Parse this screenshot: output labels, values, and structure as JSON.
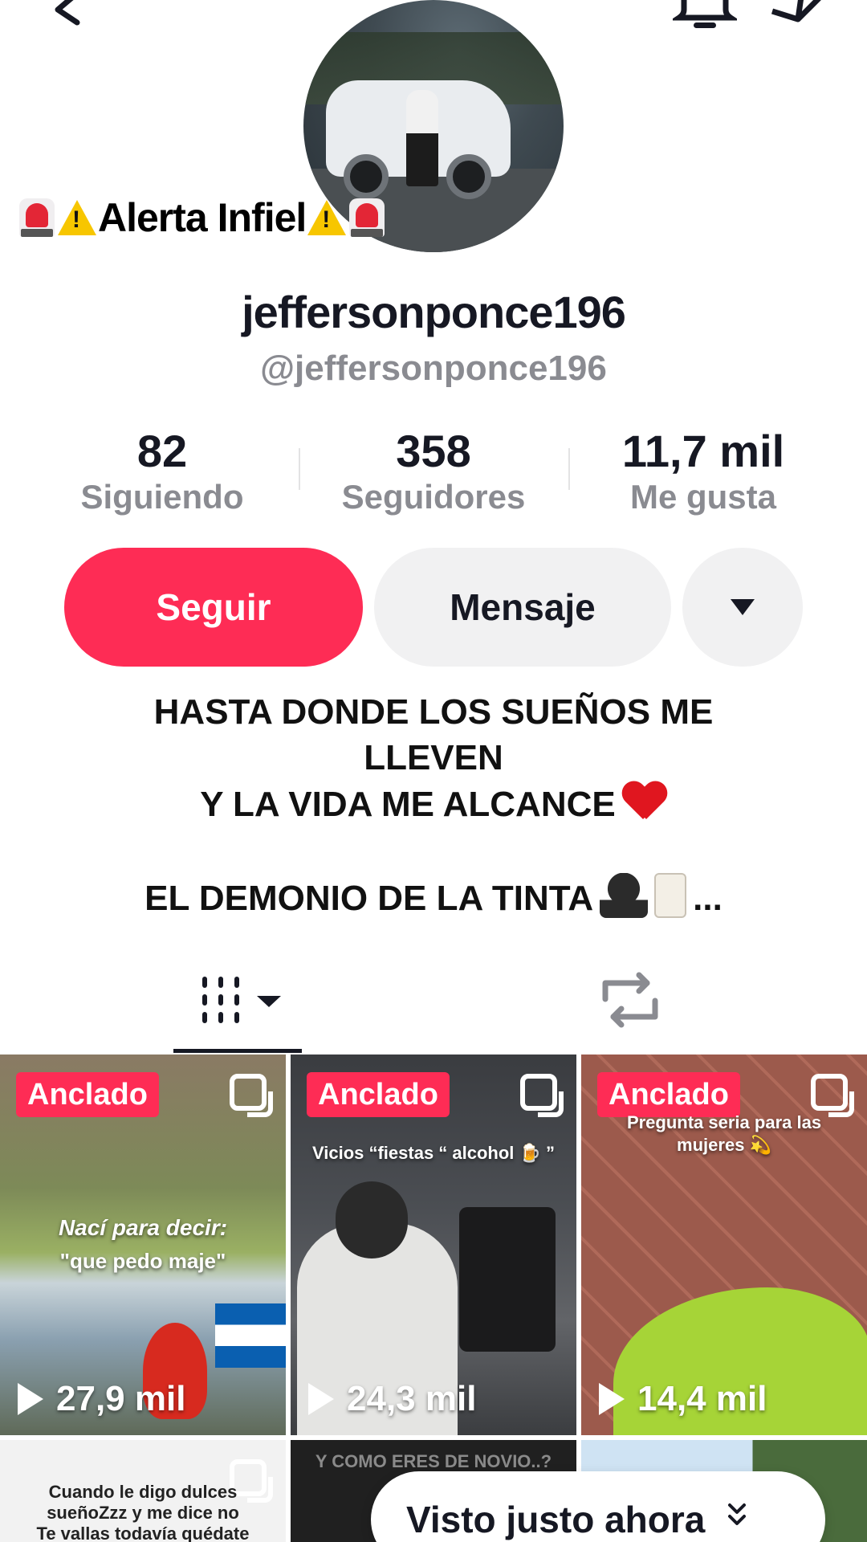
{
  "profile": {
    "display_name": "jeffersonponce196",
    "handle": "@jeffersonponce196"
  },
  "overlay_caption": {
    "text": "Alerta Infiel",
    "leading_emojis": [
      "siren",
      "warning"
    ],
    "trailing_emojis": [
      "warning",
      "siren"
    ]
  },
  "stats": [
    {
      "value": "82",
      "label": "Siguiendo"
    },
    {
      "value": "358",
      "label": "Seguidores"
    },
    {
      "value": "11,7 mil",
      "label": "Me gusta"
    }
  ],
  "actions": {
    "follow_label": "Seguir",
    "message_label": "Mensaje",
    "more_icon": "caret-down-icon"
  },
  "bio": {
    "line1": "HASTA DONDE LOS SUEÑOS ME",
    "line2": "LLEVEN",
    "line3": "Y LA VIDA ME ALCANCE",
    "line4": "EL DEMONIO DE LA TINTA",
    "ellipsis": "..."
  },
  "tabs": {
    "videos_icon": "grid-icon",
    "repost_icon": "repost-icon"
  },
  "videos": [
    {
      "pinned_label": "Anclado",
      "overlay_line1": "Nací para decir:",
      "overlay_line2": "\"que pedo maje\"",
      "views": "27,9 mil"
    },
    {
      "pinned_label": "Anclado",
      "overlay_line1": "Vicios “fiestas “ alcohol 🍺 ”",
      "views": "24,3 mil"
    },
    {
      "pinned_label": "Anclado",
      "overlay_line1": "Pregunta seria para las",
      "overlay_line2": "mujeres 💫",
      "views": "14,4 mil"
    },
    {
      "overlay_line1": "Cuando le digo dulces",
      "overlay_line2": "sueñoZzz y me dice no",
      "overlay_line3": "Te vallas todavía quédate"
    },
    {
      "overlay_line1": "Y COMO ERES DE NOVIO..?"
    },
    {}
  ],
  "seen_pill": {
    "label": "Visto justo ahora"
  },
  "colors": {
    "accent": "#fe2c55",
    "button_gray": "#f1f1f2",
    "secondary_text": "#8a8b91"
  }
}
